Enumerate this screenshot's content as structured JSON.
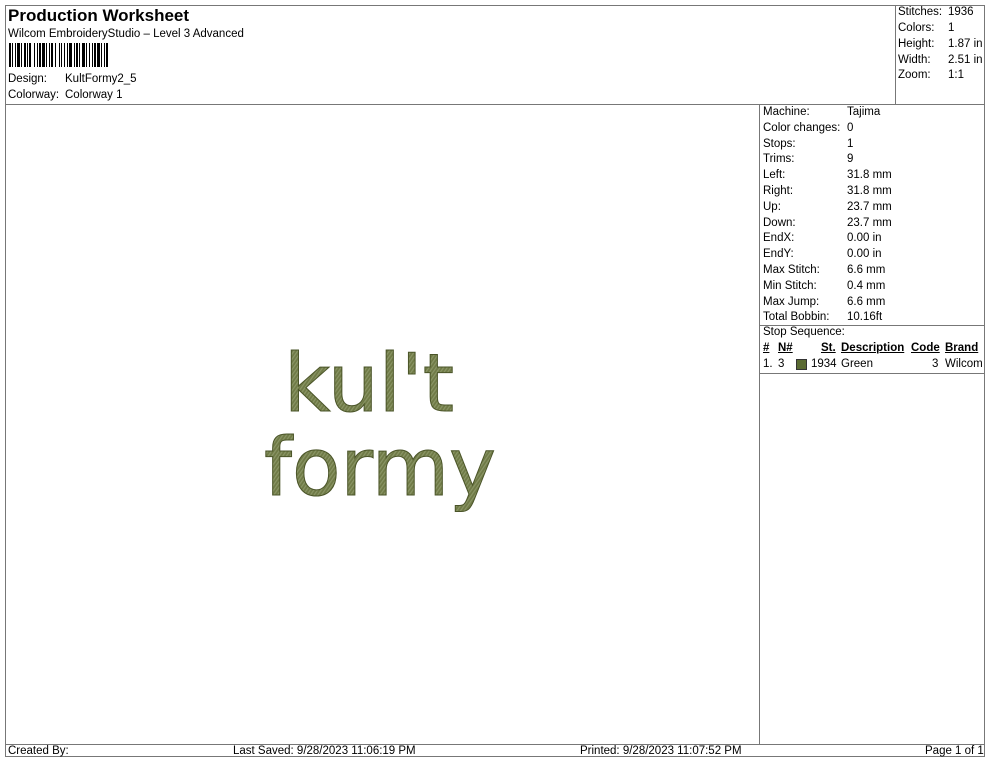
{
  "header": {
    "title": "Production Worksheet",
    "software": "Wilcom EmbroideryStudio – Level 3 Advanced",
    "design_label": "Design:",
    "design_value": "KultFormy2_5",
    "colorway_label": "Colorway:",
    "colorway_value": "Colorway 1"
  },
  "summary": [
    {
      "label": "Stitches:",
      "value": "1936"
    },
    {
      "label": "Colors:",
      "value": "1"
    },
    {
      "label": "Height:",
      "value": "1.87 in"
    },
    {
      "label": "Width:",
      "value": "2.51 in"
    },
    {
      "label": "Zoom:",
      "value": "1:1"
    }
  ],
  "details": [
    {
      "label": "Machine:",
      "value": "Tajima"
    },
    {
      "label": "Color changes:",
      "value": "0"
    },
    {
      "label": "Stops:",
      "value": "1"
    },
    {
      "label": "Trims:",
      "value": "9"
    },
    {
      "label": "Left:",
      "value": "31.8 mm"
    },
    {
      "label": "Right:",
      "value": "31.8 mm"
    },
    {
      "label": "Up:",
      "value": "23.7 mm"
    },
    {
      "label": "Down:",
      "value": "23.7 mm"
    },
    {
      "label": "EndX:",
      "value": "0.00 in"
    },
    {
      "label": "EndY:",
      "value": "0.00 in"
    },
    {
      "label": "Max Stitch:",
      "value": "6.6 mm"
    },
    {
      "label": "Min Stitch:",
      "value": "0.4 mm"
    },
    {
      "label": "Max Jump:",
      "value": "6.6 mm"
    },
    {
      "label": "Total Bobbin:",
      "value": "10.16ft"
    }
  ],
  "stop_sequence": {
    "title": "Stop Sequence:",
    "columns": {
      "num": "#",
      "n": "N#",
      "st": "St.",
      "description": "Description",
      "code": "Code",
      "brand": "Brand"
    },
    "rows": [
      {
        "num": "1.",
        "n": "3",
        "st": "1934",
        "description": "Green",
        "code": "3",
        "brand": "Wilcom",
        "color": "#5a6a32"
      }
    ]
  },
  "design_preview": {
    "line1": "kul't",
    "line2": "formy",
    "thread_color": "#6f7a46"
  },
  "footer": {
    "created_by": "Created By:",
    "last_saved": "Last Saved: 9/28/2023 11:06:19 PM",
    "printed": "Printed: 9/28/2023 11:07:52 PM",
    "page": "Page 1 of 1"
  }
}
